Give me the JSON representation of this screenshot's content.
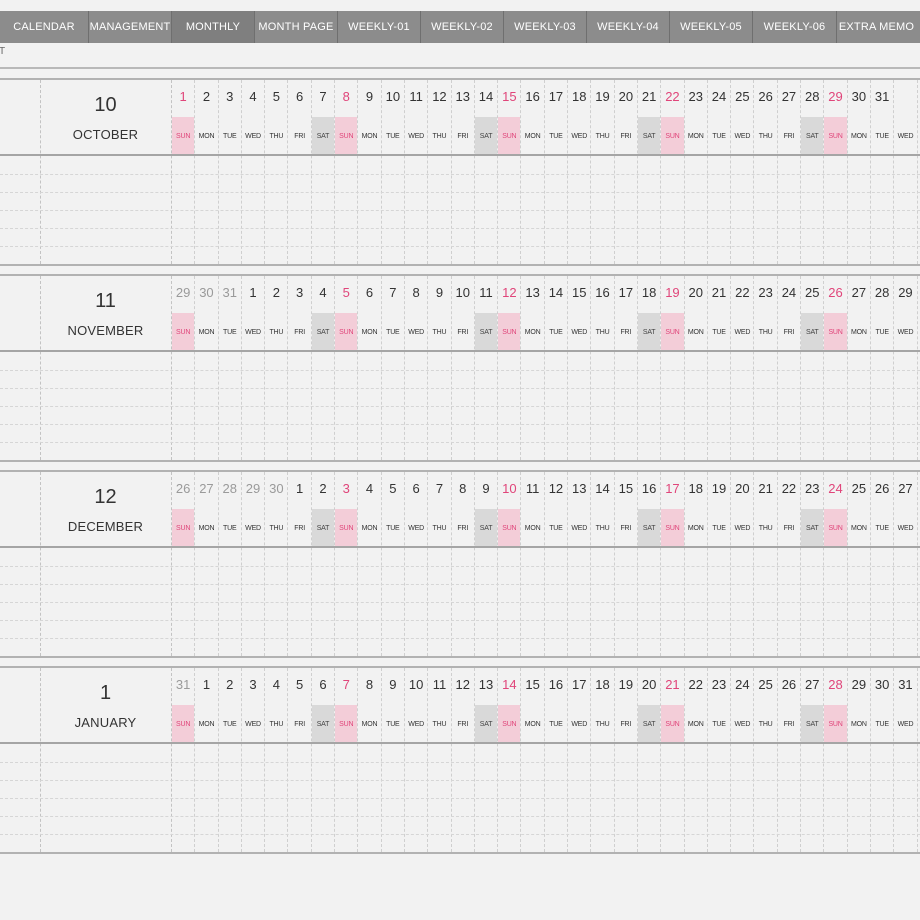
{
  "tabs": [
    {
      "label": "CALENDAR",
      "name": "tab-calendar"
    },
    {
      "label": "MANAGEMENT",
      "name": "tab-management"
    },
    {
      "label": "MONTHLY",
      "name": "tab-monthly"
    },
    {
      "label": "MONTH PAGE",
      "name": "tab-month-page"
    },
    {
      "label": "WEEKLY-01",
      "name": "tab-weekly-01"
    },
    {
      "label": "WEEKLY-02",
      "name": "tab-weekly-02"
    },
    {
      "label": "WEEKLY-03",
      "name": "tab-weekly-03"
    },
    {
      "label": "WEEKLY-04",
      "name": "tab-weekly-04"
    },
    {
      "label": "WEEKLY-05",
      "name": "tab-weekly-05"
    },
    {
      "label": "WEEKLY-06",
      "name": "tab-weekly-06"
    },
    {
      "label": "EXTRA MEMO",
      "name": "tab-extra-memo"
    }
  ],
  "stub_text": "T",
  "weekday_labels": [
    "SUN",
    "MON",
    "TUE",
    "WED",
    "THU",
    "FRI",
    "SAT"
  ],
  "colors": {
    "sunday": "#e0457a",
    "sunday_bg": "#f3cdd8",
    "saturday_bg": "#d9d9d9",
    "tabbar": "#8c8c8c"
  },
  "months": [
    {
      "number": "10",
      "name": "OCTOBER",
      "days": [
        {
          "n": "1",
          "w": "SUN"
        },
        {
          "n": "2",
          "w": "MON"
        },
        {
          "n": "3",
          "w": "TUE"
        },
        {
          "n": "4",
          "w": "WED"
        },
        {
          "n": "5",
          "w": "THU"
        },
        {
          "n": "6",
          "w": "FRI"
        },
        {
          "n": "7",
          "w": "SAT"
        },
        {
          "n": "8",
          "w": "SUN"
        },
        {
          "n": "9",
          "w": "MON"
        },
        {
          "n": "10",
          "w": "TUE"
        },
        {
          "n": "11",
          "w": "WED"
        },
        {
          "n": "12",
          "w": "THU"
        },
        {
          "n": "13",
          "w": "FRI"
        },
        {
          "n": "14",
          "w": "SAT"
        },
        {
          "n": "15",
          "w": "SUN"
        },
        {
          "n": "16",
          "w": "MON"
        },
        {
          "n": "17",
          "w": "TUE"
        },
        {
          "n": "18",
          "w": "WED"
        },
        {
          "n": "19",
          "w": "THU"
        },
        {
          "n": "20",
          "w": "FRI"
        },
        {
          "n": "21",
          "w": "SAT"
        },
        {
          "n": "22",
          "w": "SUN"
        },
        {
          "n": "23",
          "w": "MON"
        },
        {
          "n": "24",
          "w": "TUE"
        },
        {
          "n": "25",
          "w": "WED"
        },
        {
          "n": "26",
          "w": "THU"
        },
        {
          "n": "27",
          "w": "FRI"
        },
        {
          "n": "28",
          "w": "SAT"
        },
        {
          "n": "29",
          "w": "SUN"
        },
        {
          "n": "30",
          "w": "MON"
        },
        {
          "n": "31",
          "w": "TUE"
        },
        {
          "n": "",
          "w": "WED"
        }
      ]
    },
    {
      "number": "11",
      "name": "NOVEMBER",
      "days": [
        {
          "n": "29",
          "w": "SUN",
          "dim": true
        },
        {
          "n": "30",
          "w": "MON",
          "dim": true
        },
        {
          "n": "31",
          "w": "TUE",
          "dim": true
        },
        {
          "n": "1",
          "w": "WED"
        },
        {
          "n": "2",
          "w": "THU"
        },
        {
          "n": "3",
          "w": "FRI"
        },
        {
          "n": "4",
          "w": "SAT"
        },
        {
          "n": "5",
          "w": "SUN"
        },
        {
          "n": "6",
          "w": "MON"
        },
        {
          "n": "7",
          "w": "TUE"
        },
        {
          "n": "8",
          "w": "WED"
        },
        {
          "n": "9",
          "w": "THU"
        },
        {
          "n": "10",
          "w": "FRI"
        },
        {
          "n": "11",
          "w": "SAT"
        },
        {
          "n": "12",
          "w": "SUN"
        },
        {
          "n": "13",
          "w": "MON"
        },
        {
          "n": "14",
          "w": "TUE"
        },
        {
          "n": "15",
          "w": "WED"
        },
        {
          "n": "16",
          "w": "THU"
        },
        {
          "n": "17",
          "w": "FRI"
        },
        {
          "n": "18",
          "w": "SAT"
        },
        {
          "n": "19",
          "w": "SUN"
        },
        {
          "n": "20",
          "w": "MON"
        },
        {
          "n": "21",
          "w": "TUE"
        },
        {
          "n": "22",
          "w": "WED"
        },
        {
          "n": "23",
          "w": "THU"
        },
        {
          "n": "24",
          "w": "FRI"
        },
        {
          "n": "25",
          "w": "SAT"
        },
        {
          "n": "26",
          "w": "SUN"
        },
        {
          "n": "27",
          "w": "MON"
        },
        {
          "n": "28",
          "w": "TUE"
        },
        {
          "n": "29",
          "w": "WED"
        }
      ]
    },
    {
      "number": "12",
      "name": "DECEMBER",
      "days": [
        {
          "n": "26",
          "w": "SUN",
          "dim": true
        },
        {
          "n": "27",
          "w": "MON",
          "dim": true
        },
        {
          "n": "28",
          "w": "TUE",
          "dim": true
        },
        {
          "n": "29",
          "w": "WED",
          "dim": true
        },
        {
          "n": "30",
          "w": "THU",
          "dim": true
        },
        {
          "n": "1",
          "w": "FRI"
        },
        {
          "n": "2",
          "w": "SAT"
        },
        {
          "n": "3",
          "w": "SUN"
        },
        {
          "n": "4",
          "w": "MON"
        },
        {
          "n": "5",
          "w": "TUE"
        },
        {
          "n": "6",
          "w": "WED"
        },
        {
          "n": "7",
          "w": "THU"
        },
        {
          "n": "8",
          "w": "FRI"
        },
        {
          "n": "9",
          "w": "SAT"
        },
        {
          "n": "10",
          "w": "SUN"
        },
        {
          "n": "11",
          "w": "MON"
        },
        {
          "n": "12",
          "w": "TUE"
        },
        {
          "n": "13",
          "w": "WED"
        },
        {
          "n": "14",
          "w": "THU"
        },
        {
          "n": "15",
          "w": "FRI"
        },
        {
          "n": "16",
          "w": "SAT"
        },
        {
          "n": "17",
          "w": "SUN"
        },
        {
          "n": "18",
          "w": "MON"
        },
        {
          "n": "19",
          "w": "TUE"
        },
        {
          "n": "20",
          "w": "WED"
        },
        {
          "n": "21",
          "w": "THU"
        },
        {
          "n": "22",
          "w": "FRI"
        },
        {
          "n": "23",
          "w": "SAT"
        },
        {
          "n": "24",
          "w": "SUN"
        },
        {
          "n": "25",
          "w": "MON"
        },
        {
          "n": "26",
          "w": "TUE"
        },
        {
          "n": "27",
          "w": "WED"
        }
      ]
    },
    {
      "number": "1",
      "name": "JANUARY",
      "days": [
        {
          "n": "31",
          "w": "SUN",
          "dim": true
        },
        {
          "n": "1",
          "w": "MON"
        },
        {
          "n": "2",
          "w": "TUE"
        },
        {
          "n": "3",
          "w": "WED"
        },
        {
          "n": "4",
          "w": "THU"
        },
        {
          "n": "5",
          "w": "FRI"
        },
        {
          "n": "6",
          "w": "SAT"
        },
        {
          "n": "7",
          "w": "SUN"
        },
        {
          "n": "8",
          "w": "MON"
        },
        {
          "n": "9",
          "w": "TUE"
        },
        {
          "n": "10",
          "w": "WED"
        },
        {
          "n": "11",
          "w": "THU"
        },
        {
          "n": "12",
          "w": "FRI"
        },
        {
          "n": "13",
          "w": "SAT"
        },
        {
          "n": "14",
          "w": "SUN"
        },
        {
          "n": "15",
          "w": "MON"
        },
        {
          "n": "16",
          "w": "TUE"
        },
        {
          "n": "17",
          "w": "WED"
        },
        {
          "n": "18",
          "w": "THU"
        },
        {
          "n": "19",
          "w": "FRI"
        },
        {
          "n": "20",
          "w": "SAT"
        },
        {
          "n": "21",
          "w": "SUN"
        },
        {
          "n": "22",
          "w": "MON"
        },
        {
          "n": "23",
          "w": "TUE"
        },
        {
          "n": "24",
          "w": "WED"
        },
        {
          "n": "25",
          "w": "THU"
        },
        {
          "n": "26",
          "w": "FRI"
        },
        {
          "n": "27",
          "w": "SAT"
        },
        {
          "n": "28",
          "w": "SUN"
        },
        {
          "n": "29",
          "w": "MON"
        },
        {
          "n": "30",
          "w": "TUE"
        },
        {
          "n": "31",
          "w": "WED"
        }
      ]
    }
  ]
}
